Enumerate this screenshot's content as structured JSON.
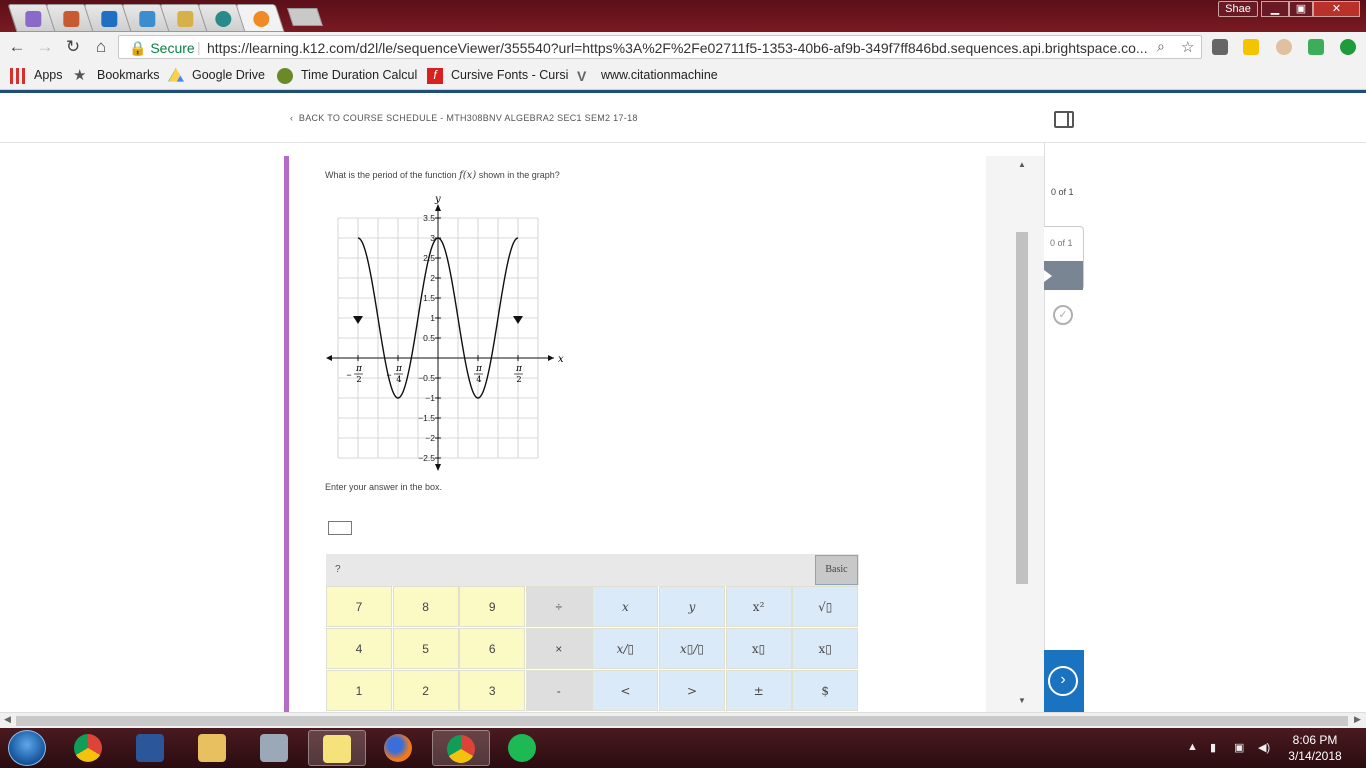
{
  "browser": {
    "profile": "Shae",
    "window_buttons": [
      "minimize",
      "maximize",
      "close"
    ],
    "tabs": [
      {
        "icon": "mail-icon",
        "color": "#8a6ac8"
      },
      {
        "icon": "photo-icon",
        "color": "#c85a32"
      },
      {
        "icon": "outlook-icon",
        "color": "#1f6fc4"
      },
      {
        "icon": "cursor-icon",
        "color": "#3a8ed0"
      },
      {
        "icon": "folder-icon",
        "color": "#d8b048"
      },
      {
        "icon": "p-icon",
        "color": "#2a8a8a"
      },
      {
        "icon": "brightspace-icon",
        "color": "#f08a24"
      }
    ],
    "security_label": "Secure",
    "url": "https://learning.k12.com/d2l/le/sequenceViewer/355540?url=https%3A%2F%2Fe02711f5-1353-40b6-af9b-349f7ff846bd.sequences.api.brightspace.co...",
    "bookmarks": [
      {
        "label": "Apps",
        "icon": "apps-grid-icon"
      },
      {
        "label": "Bookmarks",
        "icon": "star-icon"
      },
      {
        "label": "Google Drive",
        "icon": "google-drive-icon"
      },
      {
        "label": "Time Duration Calcul",
        "icon": "dot-icon"
      },
      {
        "label": "Cursive Fonts - Cursi",
        "icon": "f-icon"
      },
      {
        "label": "www.citationmachine",
        "icon": "v-icon"
      }
    ]
  },
  "page": {
    "back_link": "BACK TO COURSE SCHEDULE - MTH308BNV  ALGEBRA2  SEC1  SEM2  17-18",
    "question_prefix": "What is the period of the function ",
    "question_func": "f(x)",
    "question_suffix": " shown in the graph?",
    "enter_prompt": "Enter your answer in the box.",
    "answer_value": "",
    "keypad": {
      "help_label": "?",
      "mode_label": "Basic",
      "rows": [
        [
          "7",
          "8",
          "9",
          "÷",
          "x",
          "y",
          "x²",
          "√▯"
        ],
        [
          "4",
          "5",
          "6",
          "×",
          "x/▯",
          "x▯/▯",
          "x▯",
          "x▯"
        ],
        [
          "1",
          "2",
          "3",
          "-",
          "<",
          ">",
          "±",
          "$"
        ]
      ]
    }
  },
  "sidebar": {
    "progress_text": "0 of 1",
    "card_text": "0 of 1",
    "next_label": "›"
  },
  "chart_data": {
    "type": "line",
    "title": "",
    "xlabel": "x",
    "ylabel": "y",
    "x_tick_labels": [
      "-π/2",
      "-π/4",
      "π/4",
      "π/2"
    ],
    "x_tick_values": [
      -1.5708,
      -0.7854,
      0.7854,
      1.5708
    ],
    "y_tick_labels": [
      "3.5",
      "3",
      "2.5",
      "2",
      "1.5",
      "1",
      "0.5",
      "-0.5",
      "-1",
      "-1.5",
      "-2",
      "-2.5"
    ],
    "xlim": [
      -2.0,
      2.0
    ],
    "ylim": [
      -2.5,
      3.5
    ],
    "grid": true,
    "series": [
      {
        "function": "2*cos(4x)+1",
        "points": [
          [
            -1.5708,
            1
          ],
          [
            -1.1781,
            3
          ],
          [
            -0.7854,
            -1
          ],
          [
            0,
            3
          ],
          [
            0.7854,
            -1
          ],
          [
            1.1781,
            3
          ],
          [
            1.5708,
            1
          ]
        ]
      }
    ]
  },
  "taskbar": {
    "apps": [
      {
        "icon": "chrome-icon"
      },
      {
        "icon": "word-icon"
      },
      {
        "icon": "file-explorer-icon"
      },
      {
        "icon": "calculator-icon"
      },
      {
        "icon": "sticky-notes-icon"
      },
      {
        "icon": "firefox-icon"
      },
      {
        "icon": "chrome-icon"
      },
      {
        "icon": "spotify-icon"
      }
    ],
    "time": "8:06 PM",
    "date": "3/14/2018"
  }
}
